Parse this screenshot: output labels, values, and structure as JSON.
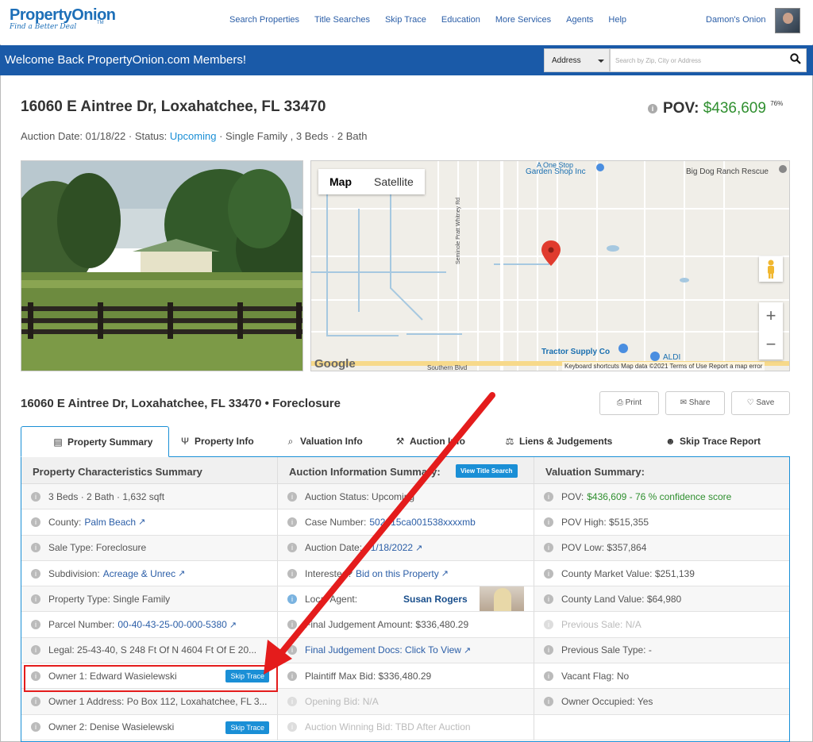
{
  "nav": {
    "logo_top": "PropertyOnion",
    "logo_tagline": "Find a Better Deal",
    "logo_tm": "TM",
    "links": [
      "Search Properties",
      "Title Searches",
      "Skip Trace",
      "Education",
      "More Services",
      "Agents",
      "Help"
    ],
    "user": "Damon's Onion"
  },
  "welcome": "Welcome Back PropertyOnion.com Members!",
  "search": {
    "type": "Address",
    "placeholder": "Search by Zip, City or Address"
  },
  "property": {
    "address": "16060 E Aintree Dr, Loxahatchee, FL 33470",
    "pov_label": "POV:",
    "pov_value": "$436,609",
    "pov_pct": "76%",
    "auction_prefix": "Auction Date: 01/18/22 · Status:",
    "status": "Upcoming",
    "details": "· Single Family , 3 Beds · 2 Bath",
    "address_full": "16060 E Aintree Dr, Loxahatchee, FL 33470 • Foreclosure"
  },
  "map": {
    "tab_map": "Map",
    "tab_satellite": "Satellite",
    "labels": [
      "A One Stop",
      "Garden Shop Inc",
      "Big Dog Ranch Rescue",
      "Tractor Supply Co",
      "ALDI",
      "Southern Blvd",
      "Seminole Pratt Whitney Rd"
    ],
    "google": "Google",
    "footer": "Keyboard shortcuts   Map data ©2021   Terms of Use   Report a map error",
    "zoom_in": "+",
    "zoom_out": "−"
  },
  "actions": {
    "print": "Print",
    "share": "Share",
    "save": "Save"
  },
  "tabs": [
    "Property Summary",
    "Property Info",
    "Valuation Info",
    "Auction Info",
    "Liens & Judgements",
    "Skip Trace Report"
  ],
  "columns": {
    "characteristics": {
      "title": "Property Characteristics Summary",
      "rows": [
        {
          "label": "3 Beds · 2 Bath · 1,632 sqft"
        },
        {
          "label": "County:",
          "link": "Palm Beach"
        },
        {
          "label": "Sale Type: Foreclosure"
        },
        {
          "label": "Subdivision:",
          "link": "Acreage & Unrec"
        },
        {
          "label": "Property Type: Single Family"
        },
        {
          "label": "Parcel Number:",
          "link": "00-40-43-25-00-000-5380"
        },
        {
          "label": "Legal: 25-43-40, S 248 Ft Of N 4604 Ft Of E 20..."
        },
        {
          "label": "Owner 1: Edward Wasielewski",
          "button": "Skip Trace"
        },
        {
          "label": "Owner 1 Address: Po Box 112, Loxahatchee, FL 3..."
        },
        {
          "label": "Owner 2: Denise Wasielewski",
          "button": "Skip Trace"
        }
      ]
    },
    "auction": {
      "title": "Auction Information Summary:",
      "title_button": "View Title Search",
      "rows": [
        {
          "label": "Auction Status: Upcoming"
        },
        {
          "label": "Case Number:",
          "link": "502015ca001538xxxxmb"
        },
        {
          "label": "Auction Date:",
          "link": "01/18/2022"
        },
        {
          "label": "Interested?",
          "link": "Bid on this Property"
        },
        {
          "label": "Local Agent:",
          "agent": "Susan Rogers"
        },
        {
          "label": "Final Judgement Amount: $336,480.29"
        },
        {
          "label": "",
          "link": "Final Judgement Docs: Click To View"
        },
        {
          "label": "Plaintiff Max Bid: $336,480.29"
        },
        {
          "label": "Opening Bid: N/A",
          "muted": true
        },
        {
          "label": "Auction Winning Bid: TBD After Auction",
          "muted": true
        }
      ]
    },
    "valuation": {
      "title": "Valuation Summary:",
      "rows": [
        {
          "label": "POV:",
          "green": "$436,609 - 76 % confidence score"
        },
        {
          "label": "POV High: $515,355"
        },
        {
          "label": "POV Low: $357,864"
        },
        {
          "label": "County Market Value: $251,139"
        },
        {
          "label": "County Land Value: $64,980"
        },
        {
          "label": "Previous Sale: N/A",
          "muted": true
        },
        {
          "label": "Previous Sale Type: -"
        },
        {
          "label": "Vacant Flag: No"
        },
        {
          "label": "Owner Occupied: Yes"
        },
        {
          "label": ""
        }
      ]
    }
  },
  "colors": {
    "brand": "#1a5aa8",
    "accent": "#1a8fd6",
    "pov_green": "#2f8f2f",
    "annotation_red": "#e41c1c"
  }
}
